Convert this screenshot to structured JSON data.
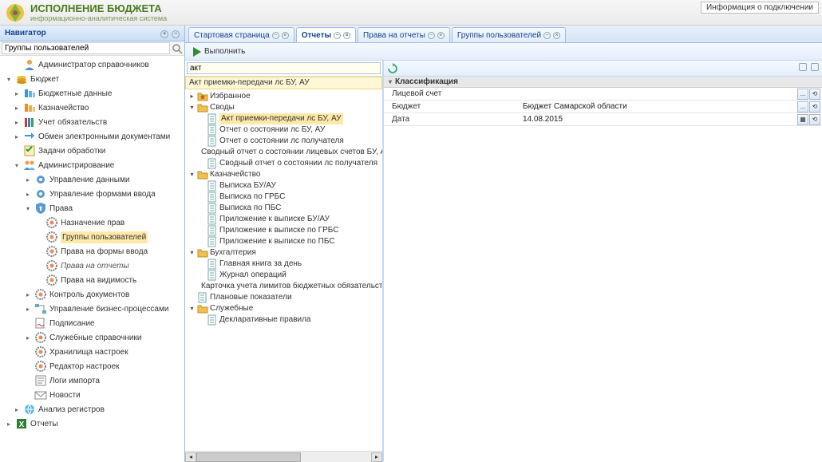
{
  "header": {
    "title": "ИСПОЛНЕНИЕ БЮДЖЕТА",
    "subtitle": "информационно-аналитическая система",
    "conn_button": "Информация о подключении"
  },
  "navigator": {
    "panel_title": "Навигатор",
    "search_value": "Группы пользователей",
    "items": [
      {
        "label": "Администратор справочников",
        "icon": "user",
        "depth": 1,
        "exp": ""
      },
      {
        "label": "Бюджет",
        "icon": "coins",
        "depth": 0,
        "exp": "▾"
      },
      {
        "label": "Бюджетные данные",
        "icon": "stack-blue",
        "depth": 1,
        "exp": "▸"
      },
      {
        "label": "Казначейство",
        "icon": "stack-orange",
        "depth": 1,
        "exp": "▸"
      },
      {
        "label": "Учет обязательств",
        "icon": "books",
        "depth": 1,
        "exp": "▸"
      },
      {
        "label": "Обмен электронными документами",
        "icon": "exchange",
        "depth": 1,
        "exp": "▸"
      },
      {
        "label": "Задачи обработки",
        "icon": "tasks",
        "depth": 1,
        "exp": ""
      },
      {
        "label": "Администрирование",
        "icon": "users",
        "depth": 1,
        "exp": "▾"
      },
      {
        "label": "Управление данными",
        "icon": "gear-blue",
        "depth": 2,
        "exp": "▸"
      },
      {
        "label": "Управление формами ввода",
        "icon": "gear-blue",
        "depth": 2,
        "exp": "▸"
      },
      {
        "label": "Права",
        "icon": "shield",
        "depth": 2,
        "exp": "▾"
      },
      {
        "label": "Назначение прав",
        "icon": "gear-color",
        "depth": 3,
        "exp": ""
      },
      {
        "label": "Группы пользователей",
        "icon": "gear-color",
        "depth": 3,
        "exp": "",
        "selected": true
      },
      {
        "label": "Права на формы ввода",
        "icon": "gear-color",
        "depth": 3,
        "exp": ""
      },
      {
        "label": "Права на отчеты",
        "icon": "gear-color",
        "depth": 3,
        "exp": "",
        "italic": true
      },
      {
        "label": "Права на видимость",
        "icon": "gear-color",
        "depth": 3,
        "exp": ""
      },
      {
        "label": "Контроль документов",
        "icon": "gear-color",
        "depth": 2,
        "exp": "▸"
      },
      {
        "label": "Управление бизнес-процессами",
        "icon": "flow",
        "depth": 2,
        "exp": "▸"
      },
      {
        "label": "Подписание",
        "icon": "sign",
        "depth": 2,
        "exp": ""
      },
      {
        "label": "Служебные справочники",
        "icon": "gear-color",
        "depth": 2,
        "exp": "▸"
      },
      {
        "label": "Хранилища настроек",
        "icon": "gear-color",
        "depth": 2,
        "exp": ""
      },
      {
        "label": "Редактор настроек",
        "icon": "gear-color",
        "depth": 2,
        "exp": ""
      },
      {
        "label": "Логи импорта",
        "icon": "log",
        "depth": 2,
        "exp": ""
      },
      {
        "label": "Новости",
        "icon": "mail",
        "depth": 2,
        "exp": ""
      },
      {
        "label": "Анализ регистров",
        "icon": "globe",
        "depth": 1,
        "exp": "▸"
      },
      {
        "label": "Отчеты",
        "icon": "excel",
        "depth": 0,
        "exp": "▸"
      }
    ]
  },
  "tabs": [
    {
      "label": "Стартовая страница",
      "active": false
    },
    {
      "label": "Отчеты",
      "active": true
    },
    {
      "label": "Права на отчеты",
      "active": false
    },
    {
      "label": "Группы пользователей",
      "active": false
    }
  ],
  "toolbar": {
    "run": "Выполнить"
  },
  "reports": {
    "filter_value": "акт",
    "selected_top": "Акт приемки-передачи лс БУ, АУ",
    "tree": [
      {
        "label": "Избранное",
        "icon": "folder-star",
        "depth": 0,
        "exp": "▸"
      },
      {
        "label": "Своды",
        "icon": "folder",
        "depth": 0,
        "exp": "▾"
      },
      {
        "label": "Акт приемки-передачи лс БУ, АУ",
        "icon": "doc",
        "depth": 1,
        "hl": true
      },
      {
        "label": "Отчет о состоянии лс БУ, АУ",
        "icon": "doc",
        "depth": 1
      },
      {
        "label": "Отчет о состоянии лс получателя",
        "icon": "doc",
        "depth": 1
      },
      {
        "label": "Сводный отчет о состоянии лицевых счетов БУ, АУ, ОМС",
        "icon": "doc",
        "depth": 1
      },
      {
        "label": "Сводный отчет о состоянии лс получателя",
        "icon": "doc",
        "depth": 1
      },
      {
        "label": "Казначейство",
        "icon": "folder",
        "depth": 0,
        "exp": "▾"
      },
      {
        "label": "Выписка БУ/АУ",
        "icon": "doc",
        "depth": 1
      },
      {
        "label": "Выписка по ГРБС",
        "icon": "doc",
        "depth": 1
      },
      {
        "label": "Выписка по ПБС",
        "icon": "doc",
        "depth": 1
      },
      {
        "label": "Приложение к выписке БУ/АУ",
        "icon": "doc",
        "depth": 1
      },
      {
        "label": "Приложение к выписке по ГРБС",
        "icon": "doc",
        "depth": 1
      },
      {
        "label": "Приложение к выписке по ПБС",
        "icon": "doc",
        "depth": 1
      },
      {
        "label": "Бухгалтерия",
        "icon": "folder",
        "depth": 0,
        "exp": "▾"
      },
      {
        "label": "Главная книга за день",
        "icon": "doc",
        "depth": 1
      },
      {
        "label": "Журнал операций",
        "icon": "doc",
        "depth": 1
      },
      {
        "label": "Карточка учета лимитов бюджетных обязательств (бюджетных ассигнований)",
        "icon": "doc",
        "depth": 1
      },
      {
        "label": "Плановые показатели",
        "icon": "doc",
        "depth": 0
      },
      {
        "label": "Служебные",
        "icon": "folder",
        "depth": 0,
        "exp": "▾"
      },
      {
        "label": "Декларативные правила",
        "icon": "doc",
        "depth": 1
      }
    ]
  },
  "params": {
    "group": "Классификация",
    "rows": [
      {
        "label": "Лицевой счет",
        "value": "",
        "btns": [
          "...",
          "⟲"
        ]
      },
      {
        "label": "Бюджет",
        "value": "Бюджет Самарской области",
        "btns": [
          "...",
          "⟲"
        ]
      },
      {
        "label": "Дата",
        "value": "14.08.2015",
        "btns": [
          "▦",
          "⟲"
        ]
      }
    ]
  }
}
